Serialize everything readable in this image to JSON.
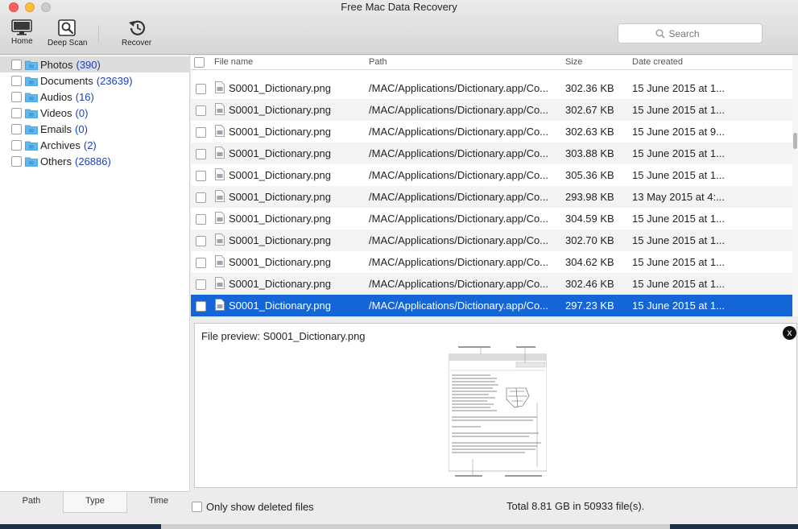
{
  "window": {
    "title": "Free Mac Data Recovery"
  },
  "toolbar": {
    "home_label": "Home",
    "deep_scan_label": "Deep Scan",
    "recover_label": "Recover",
    "search_placeholder": "Search"
  },
  "sidebar": {
    "categories": [
      {
        "name": "Photos",
        "count": "(390)",
        "selected": true
      },
      {
        "name": "Documents",
        "count": "(23639)"
      },
      {
        "name": "Audios",
        "count": "(16)"
      },
      {
        "name": "Videos",
        "count": "(0)"
      },
      {
        "name": "Emails",
        "count": "(0)"
      },
      {
        "name": "Archives",
        "count": "(2)"
      },
      {
        "name": "Others",
        "count": "(26886)"
      }
    ],
    "tabs": [
      "Path",
      "Type",
      "Time"
    ],
    "active_tab": "Type"
  },
  "file_list": {
    "columns": [
      "File name",
      "Path",
      "Size",
      "Date created"
    ],
    "rows": [
      {
        "name": "S0001_Dictionary.png",
        "path": "/MAC/Applications/Dictionary.app/Co...",
        "size": "302.36 KB",
        "date": "15 June 2015 at 1..."
      },
      {
        "name": "S0001_Dictionary.png",
        "path": "/MAC/Applications/Dictionary.app/Co...",
        "size": "302.67 KB",
        "date": "15 June 2015 at 1..."
      },
      {
        "name": "S0001_Dictionary.png",
        "path": "/MAC/Applications/Dictionary.app/Co...",
        "size": "302.63 KB",
        "date": "15 June 2015 at 9..."
      },
      {
        "name": "S0001_Dictionary.png",
        "path": "/MAC/Applications/Dictionary.app/Co...",
        "size": "303.88 KB",
        "date": "15 June 2015 at 1..."
      },
      {
        "name": "S0001_Dictionary.png",
        "path": "/MAC/Applications/Dictionary.app/Co...",
        "size": "305.36 KB",
        "date": "15 June 2015 at 1..."
      },
      {
        "name": "S0001_Dictionary.png",
        "path": "/MAC/Applications/Dictionary.app/Co...",
        "size": "293.98 KB",
        "date": "13 May 2015 at 4:..."
      },
      {
        "name": "S0001_Dictionary.png",
        "path": "/MAC/Applications/Dictionary.app/Co...",
        "size": "304.59 KB",
        "date": "15 June 2015 at 1..."
      },
      {
        "name": "S0001_Dictionary.png",
        "path": "/MAC/Applications/Dictionary.app/Co...",
        "size": "302.70 KB",
        "date": "15 June 2015 at 1..."
      },
      {
        "name": "S0001_Dictionary.png",
        "path": "/MAC/Applications/Dictionary.app/Co...",
        "size": "304.62 KB",
        "date": "15 June 2015 at 1..."
      },
      {
        "name": "S0001_Dictionary.png",
        "path": "/MAC/Applications/Dictionary.app/Co...",
        "size": "302.46 KB",
        "date": "15 June 2015 at 1..."
      },
      {
        "name": "S0001_Dictionary.png",
        "path": "/MAC/Applications/Dictionary.app/Co...",
        "size": "297.23 KB",
        "date": "15 June 2015 at 1...",
        "selected": true
      }
    ]
  },
  "preview": {
    "title": "File preview: S0001_Dictionary.png",
    "close_label": "x"
  },
  "footer": {
    "only_deleted_label": "Only show deleted files",
    "total": "Total 8.81 GB in 50933 file(s)."
  },
  "colors": {
    "selection": "#1466d6",
    "count": "#1a3fbf",
    "folder": "#5fb8ee"
  }
}
